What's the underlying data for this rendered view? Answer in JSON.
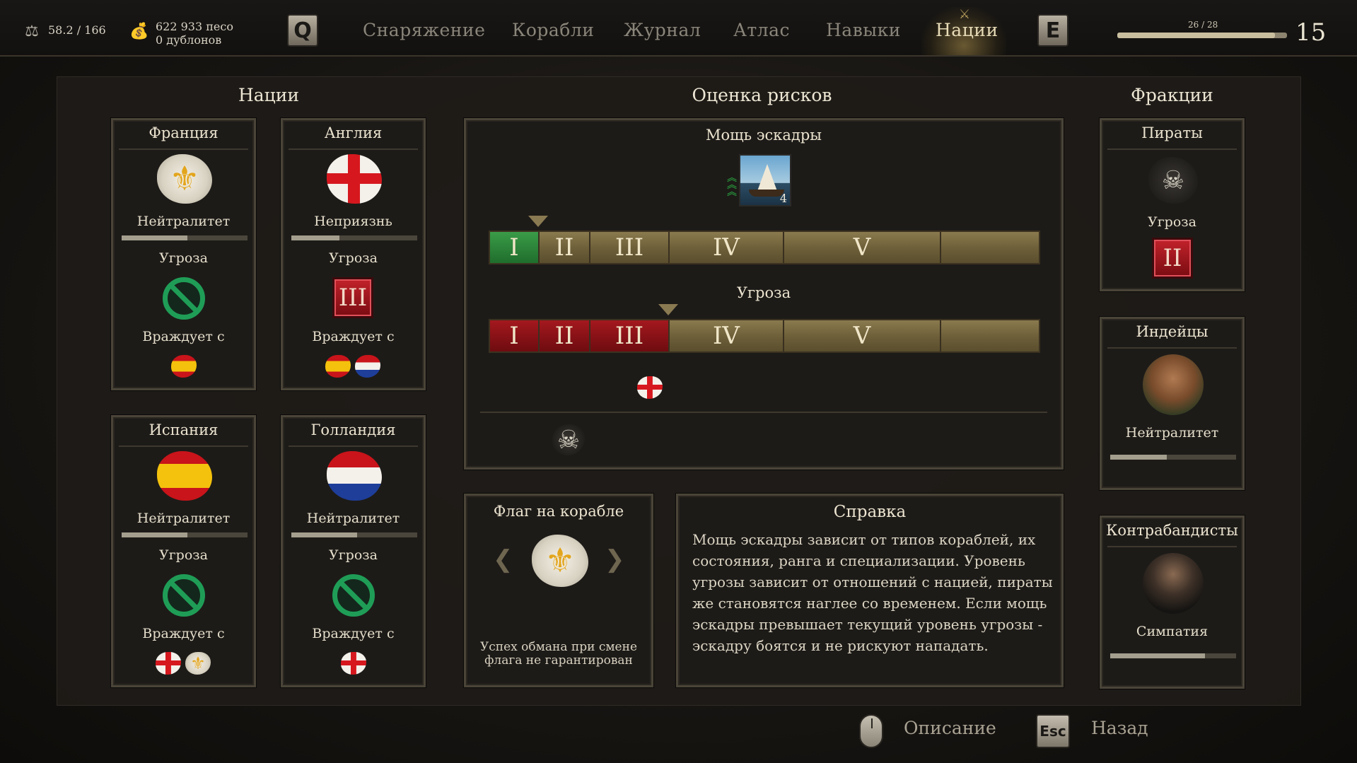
{
  "topbar": {
    "weight": "58.2 / 166",
    "weight_icon": "weight-icon",
    "money_pesos": "622 933 песо",
    "money_doubloons": "0 дублонов",
    "money_icon": "money-bag-icon",
    "key_prev": "Q",
    "key_next": "E",
    "tabs": [
      "Снаряжение",
      "Корабли",
      "Журнал",
      "Атлас",
      "Навыки",
      "Нации"
    ],
    "active_tab": "Нации",
    "rank_progress": "26 / 28",
    "rank_progress_fraction": 0.93,
    "rank_level": "15"
  },
  "sections": {
    "nations": "Нации",
    "risk": "Оценка рисков",
    "factions": "Фракции"
  },
  "nations": [
    {
      "name": "Франция",
      "relation": "Нейтралитет",
      "relation_level": 0.52,
      "threat_label": "Угроза",
      "threat": "none",
      "hostile_label": "Враждует с",
      "hostile_with": [
        "spain"
      ],
      "emblem": "france-flag-icon"
    },
    {
      "name": "Англия",
      "relation": "Неприязнь",
      "relation_level": 0.38,
      "threat_label": "Угроза",
      "threat": "III",
      "hostile_label": "Враждует с",
      "hostile_with": [
        "spain",
        "holland"
      ],
      "emblem": "england-flag-icon"
    },
    {
      "name": "Испания",
      "relation": "Нейтралитет",
      "relation_level": 0.52,
      "threat_label": "Угроза",
      "threat": "none",
      "hostile_label": "Враждует с",
      "hostile_with": [
        "england",
        "france"
      ],
      "emblem": "spain-flag-icon"
    },
    {
      "name": "Голландия",
      "relation": "Нейтралитет",
      "relation_level": 0.52,
      "threat_label": "Угроза",
      "threat": "none",
      "hostile_label": "Враждует с",
      "hostile_with": [
        "england"
      ],
      "emblem": "holland-flag-icon"
    }
  ],
  "factions": [
    {
      "name": "Пираты",
      "threat_label": "Угроза",
      "threat": "II",
      "emblem": "pirate-skull-icon"
    },
    {
      "name": "Индейцы",
      "relation": "Нейтралитет",
      "relation_level": 0.45,
      "emblem": "indian-portrait-icon"
    },
    {
      "name": "Контрабандисты",
      "relation": "Симпатия",
      "relation_level": 0.75,
      "emblem": "smuggler-portrait-icon"
    }
  ],
  "risk": {
    "squadron_power_label": "Мощь эскадры",
    "ship_count": "4",
    "threat_label": "Угроза",
    "levels": [
      "I",
      "II",
      "III",
      "IV",
      "V"
    ],
    "power_level": 1,
    "threat_level": 3,
    "colors": {
      "power": "#2e8a3c",
      "threat": "#9c1419",
      "track": "#7a6b42"
    }
  },
  "flag": {
    "title": "Флаг на корабле",
    "current": "france-flag-icon",
    "note_line1": "Успех обмана при смене",
    "note_line2": "флага не гарантирован"
  },
  "help": {
    "title": "Справка",
    "lines": [
      "Мощь эскадры зависит от типов кораблей, их",
      "состояния, ранга и специализации. Уровень",
      "угрозы зависит от отношений с нацией, пираты",
      "же становятся наглее со временем. Если мощь",
      "эскадры превышает текущий уровень угрозы -",
      "эскадру боятся и не рискуют нападать."
    ]
  },
  "footer": {
    "describe": "Описание",
    "back": "Назад",
    "esc_key": "Esc"
  }
}
